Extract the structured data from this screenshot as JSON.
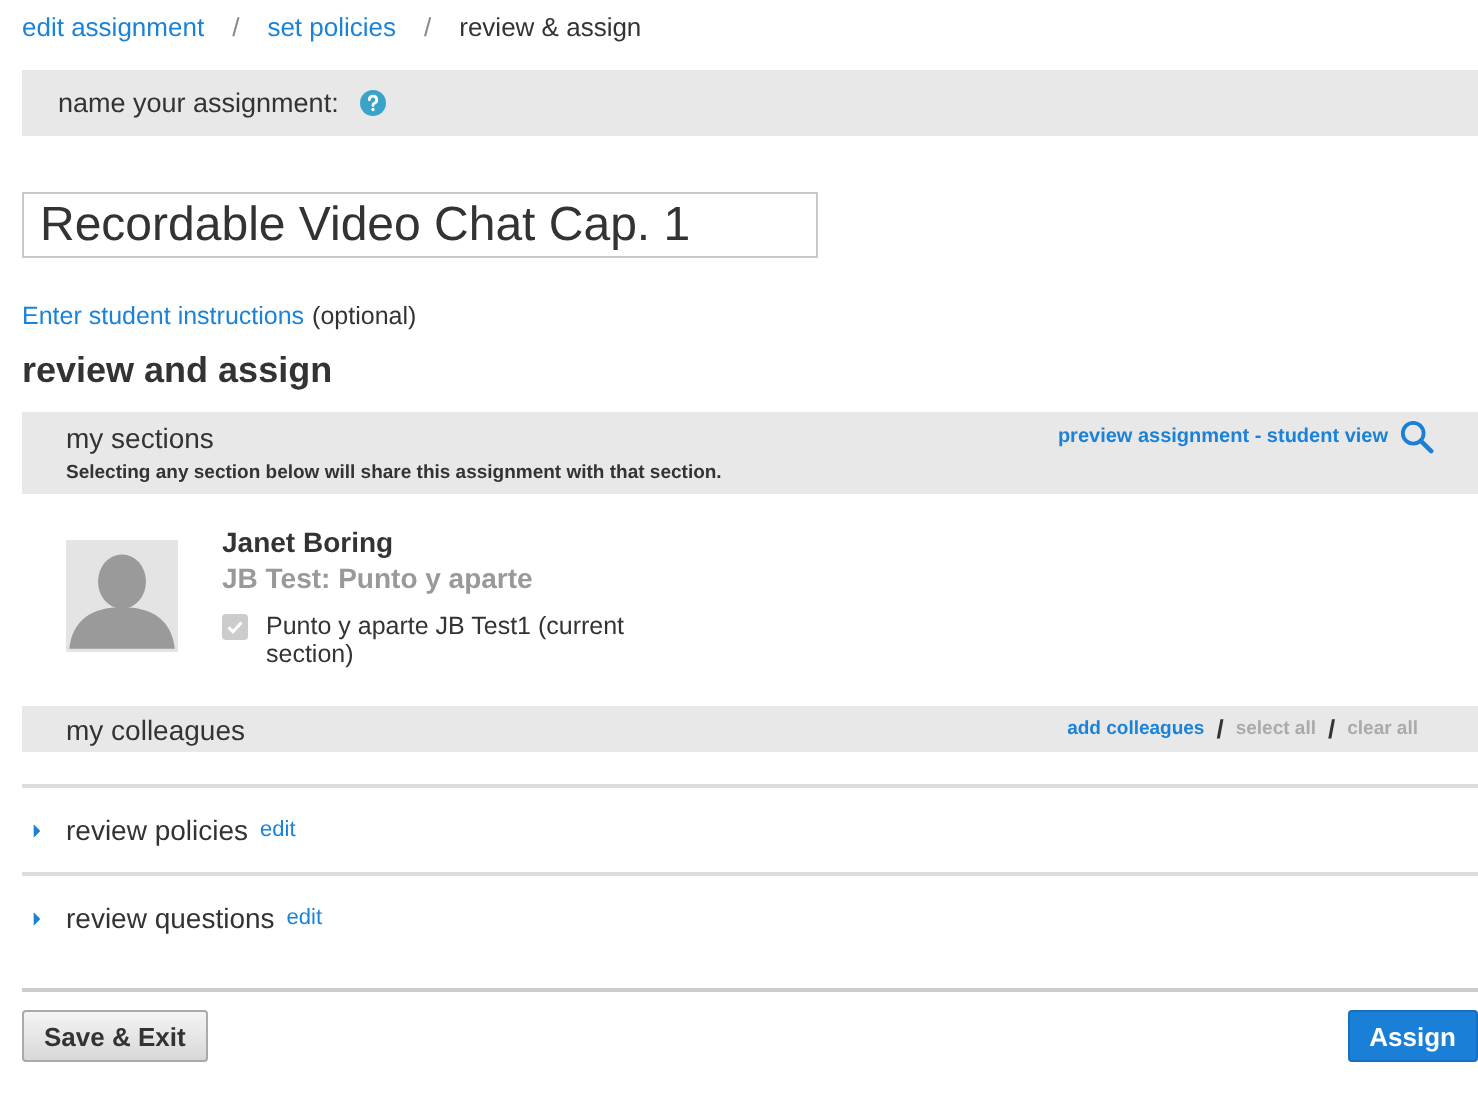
{
  "breadcrumb": [
    {
      "label": "edit assignment",
      "selected": false
    },
    {
      "label": "set policies",
      "selected": false
    },
    {
      "label": "review & assign",
      "selected": true
    }
  ],
  "breadcrumb_separator": "/",
  "name_section": {
    "label": "name your assignment:",
    "value": "Recordable Video Chat Cap. 1"
  },
  "instructions": {
    "link": "Enter student instructions",
    "note": "(optional)"
  },
  "heading": "review and assign",
  "sections": {
    "title": "my sections",
    "preview_link": "preview assignment - student view",
    "note": "Selecting any section below will share this assignment with that section.",
    "teacher": {
      "name": "Janet Boring",
      "course": "JB Test: Punto y aparte",
      "items": [
        {
          "label": "Punto y aparte JB Test1 (current section)",
          "checked": true,
          "disabled": true
        }
      ]
    }
  },
  "colleagues": {
    "title": "my colleagues",
    "separator": "/",
    "actions": [
      {
        "label": "add colleagues",
        "disabled": false
      },
      {
        "label": "select all",
        "disabled": true
      },
      {
        "label": "clear all",
        "disabled": true
      }
    ]
  },
  "reviews": [
    {
      "label": "review policies",
      "edit": "edit",
      "expanded": false
    },
    {
      "label": "review questions",
      "edit": "edit",
      "expanded": false
    }
  ],
  "buttons": [
    {
      "label": "Save & Exit",
      "kind": "secondary"
    },
    {
      "label": "Assign",
      "kind": "primary"
    }
  ]
}
